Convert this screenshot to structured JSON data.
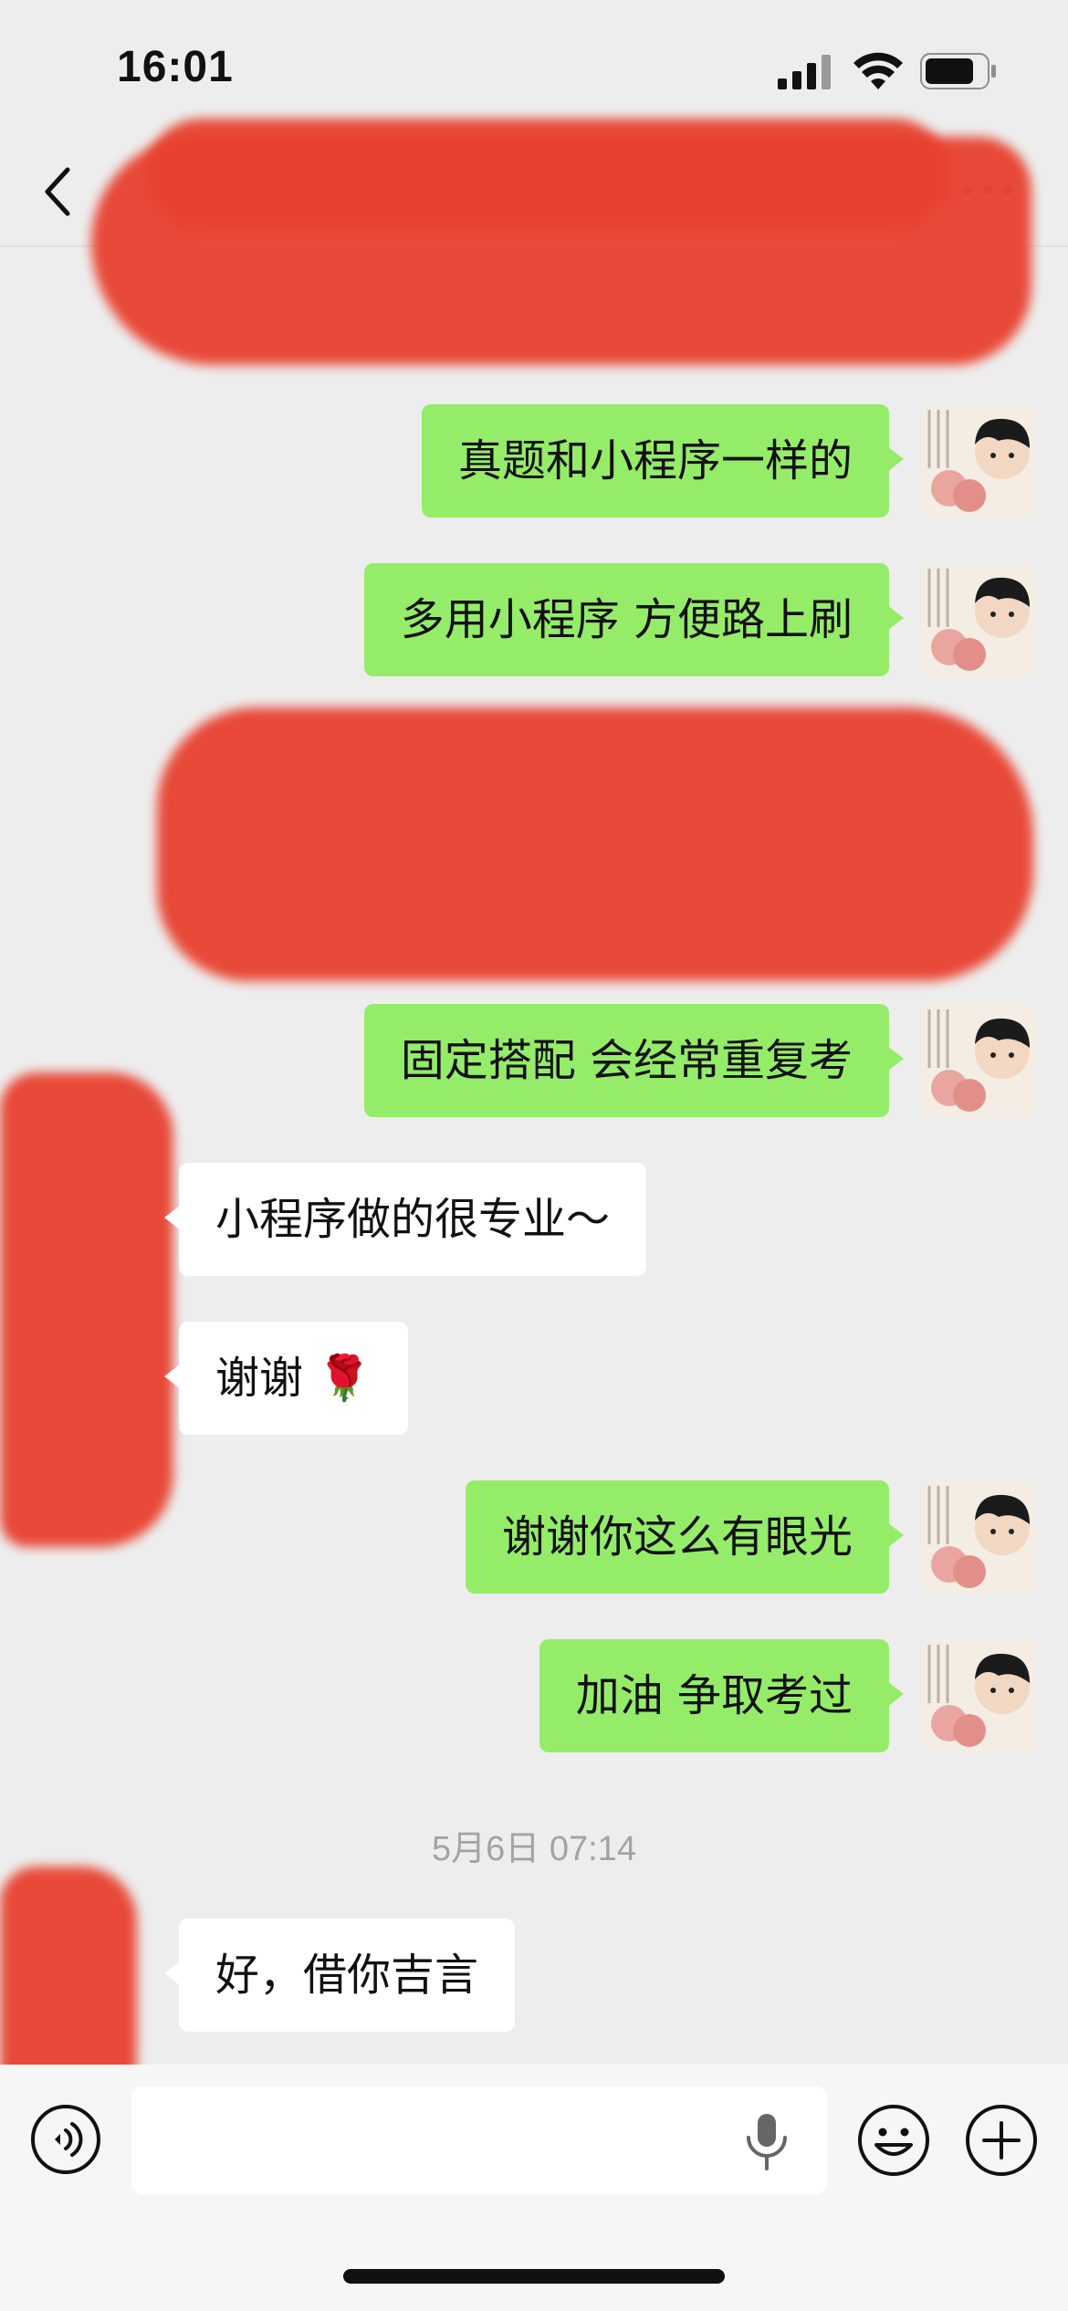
{
  "status_bar": {
    "time": "16:01"
  },
  "nav": {
    "title": ""
  },
  "messages": [
    {
      "side": "out",
      "text": "真题和小程序一样的"
    },
    {
      "side": "out",
      "text": "多用小程序  方便路上刷"
    },
    {
      "side": "out",
      "text": "固定搭配 会经常重复考"
    },
    {
      "side": "in",
      "text": "小程序做的很专业～"
    },
    {
      "side": "in",
      "text": "谢谢 🌹"
    },
    {
      "side": "out",
      "text": "谢谢你这么有眼光"
    },
    {
      "side": "out",
      "text": "加油 争取考过"
    },
    {
      "side": "in",
      "text": "好，借你吉言"
    }
  ],
  "timestamp": "5月6日 07:14",
  "input": {
    "value": "",
    "placeholder": ""
  },
  "icons": {
    "back": "chevron-left-icon",
    "more": "more-icon",
    "voice": "voice-icon",
    "mic": "mic-icon",
    "emoji": "emoji-icon",
    "plus": "plus-icon"
  },
  "colors": {
    "outgoing_bubble": "#95ec69",
    "incoming_bubble": "#ffffff",
    "background": "#ededed",
    "redaction": "#e8412f"
  }
}
